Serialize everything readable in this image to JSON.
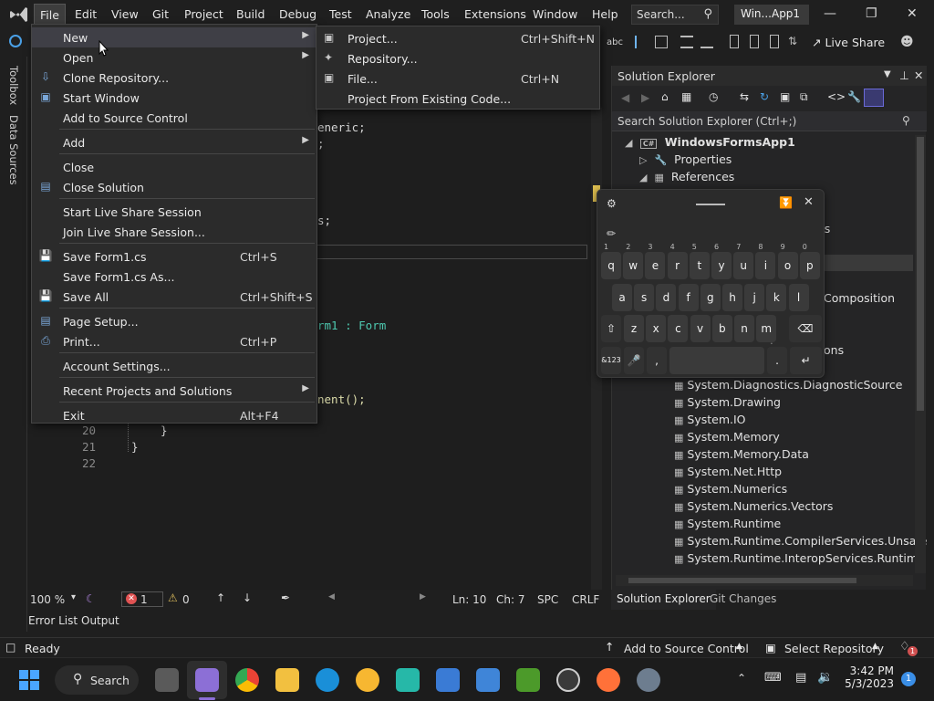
{
  "menubar": {
    "items": [
      "File",
      "Edit",
      "View",
      "Git",
      "Project",
      "Build",
      "Debug",
      "Test",
      "Analyze",
      "Tools",
      "Extensions",
      "Window",
      "Help"
    ],
    "search_label": "Search...",
    "title": "Win...App1"
  },
  "toolbar": {
    "live_share": "Live Share"
  },
  "left_rail": {
    "toolbox": "Toolbox",
    "data_sources": "Data Sources"
  },
  "editor": {
    "lines": [
      {
        "n": "",
        "text": "eneric;"
      },
      {
        "n": "",
        "text": ";"
      },
      {
        "n": "",
        "text": "s;"
      },
      {
        "n": "",
        "text": "rm1 : Form"
      },
      {
        "n": "",
        "text": "nent();"
      },
      {
        "n": "20",
        "text": "}"
      },
      {
        "n": "21",
        "text": "}"
      },
      {
        "n": "22",
        "text": ""
      }
    ]
  },
  "status_line": {
    "zoom": "100 %",
    "errors": "1",
    "warnings": "0",
    "ln": "Ln: 10",
    "ch": "Ch: 7",
    "spc": "SPC",
    "crlf": "CRLF"
  },
  "bottom_tabs": [
    "Error List",
    "Output"
  ],
  "file_menu": {
    "items": [
      {
        "label": "New",
        "shortcut": "",
        "submenu": true
      },
      {
        "label": "Open",
        "shortcut": "",
        "submenu": true
      },
      {
        "label": "Clone Repository...",
        "shortcut": ""
      },
      {
        "label": "Start Window",
        "shortcut": ""
      },
      {
        "label": "Add to Source Control",
        "shortcut": ""
      },
      {
        "label": "Add",
        "shortcut": "",
        "submenu": true
      },
      {
        "label": "Close",
        "shortcut": ""
      },
      {
        "label": "Close Solution",
        "shortcut": ""
      },
      {
        "label": "Start Live Share Session",
        "shortcut": ""
      },
      {
        "label": "Join Live Share Session...",
        "shortcut": ""
      },
      {
        "label": "Save Form1.cs",
        "shortcut": "Ctrl+S"
      },
      {
        "label": "Save Form1.cs As...",
        "shortcut": ""
      },
      {
        "label": "Save All",
        "shortcut": "Ctrl+Shift+S"
      },
      {
        "label": "Page Setup...",
        "shortcut": ""
      },
      {
        "label": "Print...",
        "shortcut": "Ctrl+P"
      },
      {
        "label": "Account Settings...",
        "shortcut": ""
      },
      {
        "label": "Recent Projects and Solutions",
        "shortcut": "",
        "submenu": true
      },
      {
        "label": "Exit",
        "shortcut": "Alt+F4"
      }
    ]
  },
  "new_submenu": {
    "items": [
      {
        "label": "Project...",
        "shortcut": "Ctrl+Shift+N"
      },
      {
        "label": "Repository...",
        "shortcut": ""
      },
      {
        "label": "File...",
        "shortcut": "Ctrl+N"
      },
      {
        "label": "Project From Existing Code...",
        "shortcut": ""
      }
    ]
  },
  "solution_explorer": {
    "title": "Solution Explorer",
    "search_placeholder": "Search Solution Explorer (Ctrl+;)",
    "tree": [
      {
        "label": "WindowsFormsApp1",
        "bold": true
      },
      {
        "label": "Properties"
      },
      {
        "label": "References"
      },
      {
        "label": "es"
      },
      {
        "label": "Composition"
      },
      {
        "label": "ons"
      },
      {
        "label": "System.Diagnostics.DiagnosticSource"
      },
      {
        "label": "System.Drawing"
      },
      {
        "label": "System.IO"
      },
      {
        "label": "System.Memory"
      },
      {
        "label": "System.Memory.Data"
      },
      {
        "label": "System.Net.Http"
      },
      {
        "label": "System.Numerics"
      },
      {
        "label": "System.Numerics.Vectors"
      },
      {
        "label": "System.Runtime"
      },
      {
        "label": "System.Runtime.CompilerServices.Unsafe"
      },
      {
        "label": "System.Runtime.InteropServices.RuntimeInfor"
      }
    ],
    "tabs": [
      "Solution Explorer",
      "Git Changes"
    ]
  },
  "keyboard": {
    "row1": [
      [
        "q",
        "1"
      ],
      [
        "w",
        "2"
      ],
      [
        "e",
        "3"
      ],
      [
        "r",
        "4"
      ],
      [
        "t",
        "5"
      ],
      [
        "y",
        "6"
      ],
      [
        "u",
        "7"
      ],
      [
        "i",
        "8"
      ],
      [
        "o",
        "9"
      ],
      [
        "p",
        "0"
      ]
    ],
    "row2": [
      "a",
      "s",
      "d",
      "f",
      "g",
      "h",
      "j",
      "k",
      "l"
    ],
    "row3": [
      "z",
      "x",
      "c",
      "v",
      "b",
      "n",
      "m"
    ],
    "symbols_key": "&123",
    "comma": ",",
    "period": ".",
    "period_sup": "?"
  },
  "status_bar": {
    "ready": "Ready",
    "add_source": "Add to Source Control",
    "select_repo": "Select Repository",
    "notif_count": "1"
  },
  "taskbar": {
    "search": "Search",
    "time": "3:42 PM",
    "date": "5/3/2023",
    "badge": "1"
  },
  "colors": {
    "accent": "#3e3ea8",
    "vs_purple": "#8c6fd6",
    "error_red": "#e05252",
    "warning_yellow": "#d9b95b"
  }
}
